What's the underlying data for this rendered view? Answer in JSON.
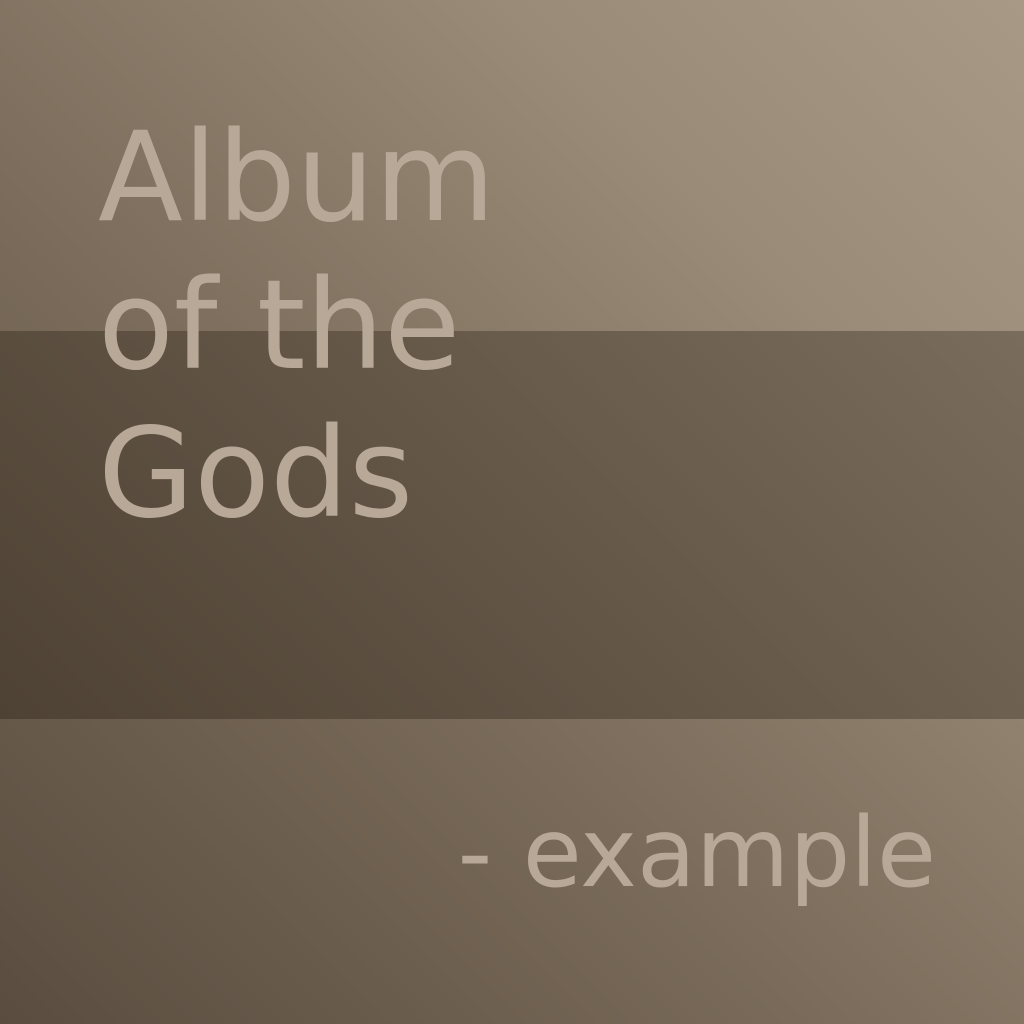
{
  "cover": {
    "title_lines": [
      "Album",
      "of the",
      "Gods"
    ],
    "subtitle": "- example"
  },
  "colors": {
    "text": "#b7a898",
    "background_light": "#a89886",
    "background_dark": "#5a4d3f",
    "band_dark": "#4e4234",
    "band_light": "#7a6c5c"
  }
}
